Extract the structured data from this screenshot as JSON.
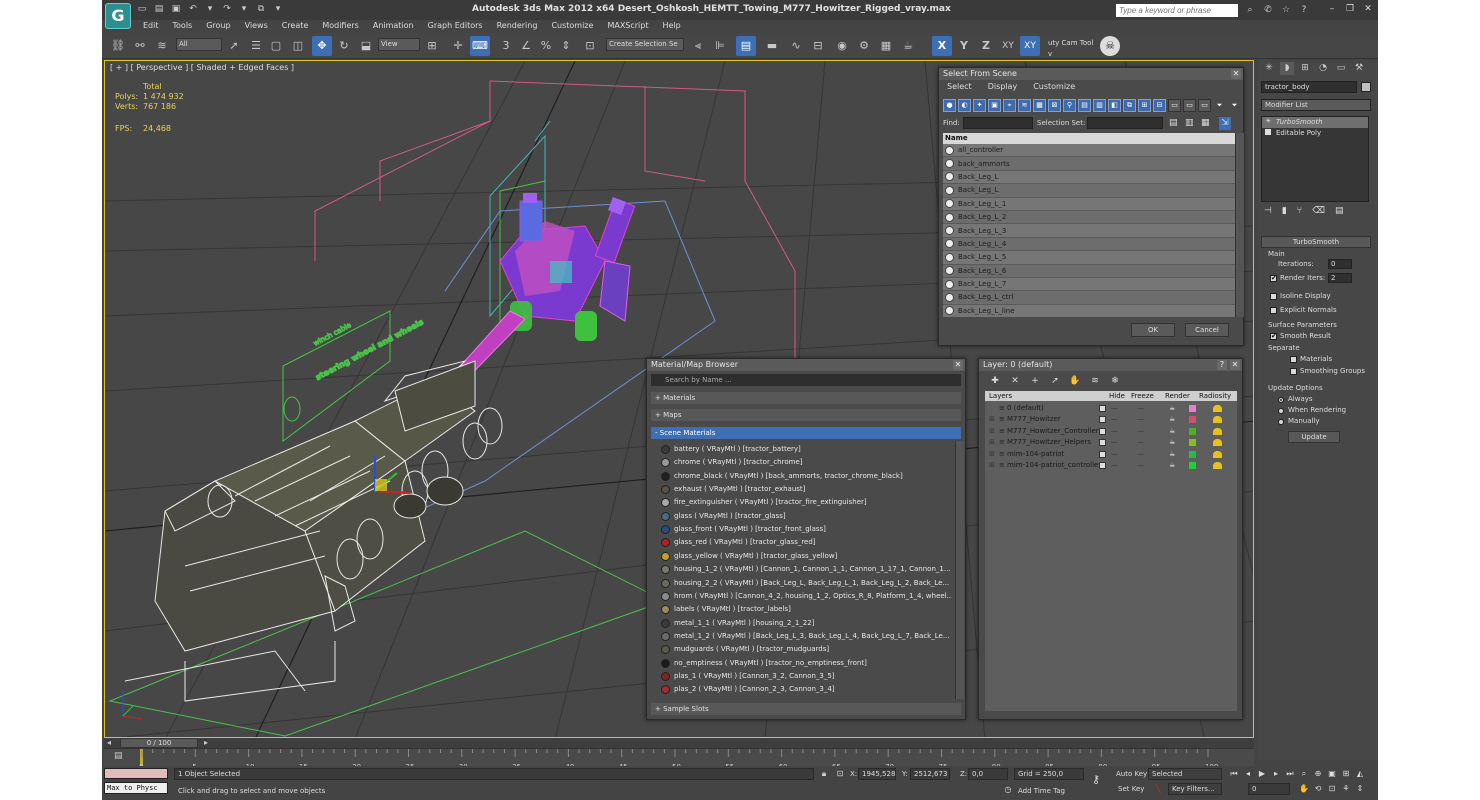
{
  "app": {
    "window_title": "Autodesk 3ds Max  2012 x64     Desert_Oshkosh_HEMTT_Towing_M777_Howitzer_Rigged_vray.max",
    "logo_letter": "G",
    "search_placeholder": "Type a keyword or phrase"
  },
  "menu": [
    "Edit",
    "Tools",
    "Group",
    "Views",
    "Create",
    "Modifiers",
    "Animation",
    "Graph Editors",
    "Rendering",
    "Customize",
    "MAXScript",
    "Help"
  ],
  "toolbar": {
    "filter_value": "All",
    "refcoord_value": "View",
    "selection_set_placeholder": "Create Selection Se",
    "axis_x": "X",
    "axis_y": "Y",
    "axis_z": "Z",
    "axis_xy": "XY",
    "axis_xy2": "XY",
    "cam_tool": "uty Cam Tool v"
  },
  "viewport": {
    "label": "[ + ] [ Perspective ] [ Shaded + Edged Faces ]",
    "stats_header": "Total",
    "polys_label": "Polys:",
    "polys_value": "1 474 932",
    "verts_label": "Verts:",
    "verts_value": "767 186",
    "fps_label": "FPS:",
    "fps_value": "24,468",
    "sign1": "steering wheel and wheels",
    "sign2": "winch cable"
  },
  "select_from_scene": {
    "title": "Select From Scene",
    "menus": [
      "Select",
      "Display",
      "Customize"
    ],
    "find_label": "Find:",
    "selset_label": "Selection Set:",
    "column_name": "Name",
    "items": [
      "all_controller",
      "back_ammorts",
      "Back_Leg_L",
      "Back_Leg_L",
      "Back_Leg_L_1",
      "Back_Leg_L_2",
      "Back_Leg_L_3",
      "Back_Leg_L_4",
      "Back_Leg_L_5",
      "Back_Leg_L_6",
      "Back_Leg_L_7",
      "Back_Leg_L_ctrl",
      "Back_Leg_L_line"
    ],
    "ok": "OK",
    "cancel": "Cancel"
  },
  "material_browser": {
    "title": "Material/Map Browser",
    "search_placeholder": "Search by Name ...",
    "groups": {
      "materials": "+ Materials",
      "maps": "+ Maps",
      "scene_materials": "- Scene Materials",
      "sample_slots": "+ Sample Slots"
    },
    "items": [
      {
        "text": "battery  ( VRayMtl )  [tractor_battery]",
        "color": "#3a3a3a"
      },
      {
        "text": "chrome  ( VRayMtl )  [tractor_chrome]",
        "color": "#9a9a9a"
      },
      {
        "text": "chrome_black  ( VRayMtl )  [back_ammorts, tractor_chrome_black]",
        "color": "#202020"
      },
      {
        "text": "exhaust  ( VRayMtl )  [tractor_exhaust]",
        "color": "#5a5048"
      },
      {
        "text": "fire_extinguisher  ( VRayMtl )  [tractor_fire_extinguisher]",
        "color": "#aaaaaa"
      },
      {
        "text": "glass  ( VRayMtl )  [tractor_glass]",
        "color": "#4a6a8a"
      },
      {
        "text": "glass_front  ( VRayMtl )  [tractor_front_glass]",
        "color": "#2a4a7a"
      },
      {
        "text": "glass_red  ( VRayMtl )  [tractor_glass_red]",
        "color": "#b02020"
      },
      {
        "text": "glass_yellow  ( VRayMtl )  [tractor_glass_yellow]",
        "color": "#c8a020"
      },
      {
        "text": "housing_1_2  ( VRayMtl )  [Cannon_1, Cannon_1_1, Cannon_1_17_1, Cannon_1...",
        "color": "#7a7a6a"
      },
      {
        "text": "housing_2_2  ( VRayMtl )  [Back_Leg_L, Back_Leg_L_1, Back_Leg_L_2, Back_Le...",
        "color": "#6a6a5a"
      },
      {
        "text": "hrom  ( VRayMtl )  [Cannon_4_2, housing_1_2, Optics_R_8, Platform_1_4, wheel...",
        "color": "#8a8a8a"
      },
      {
        "text": "labels  ( VRayMtl )  [tractor_labels]",
        "color": "#a08a60"
      },
      {
        "text": "metal_1_1  ( VRayMtl )  [housing_2_1_22]",
        "color": "#3a3a3a"
      },
      {
        "text": "metal_1_2  ( VRayMtl )  [Back_Leg_L_3, Back_Leg_L_4, Back_Leg_L_7, Back_Le...",
        "color": "#6a6a6a"
      },
      {
        "text": "mudguards  ( VRayMtl )  [tractor_mudguards]",
        "color": "#5a5a4a"
      },
      {
        "text": "no_emptiness  ( VRayMtl )  [tractor_no_emptiness_front]",
        "color": "#1a1a1a"
      },
      {
        "text": "plas_1  ( VRayMtl )  [Cannon_3_2, Cannon_3_5]",
        "color": "#8a2020"
      },
      {
        "text": "plas_2  ( VRayMtl )  [Cannon_2_3, Cannon_3_4]",
        "color": "#9a3030"
      }
    ]
  },
  "layer": {
    "title": "Layer: 0 (default)",
    "help": "?",
    "columns": {
      "layers": "Layers",
      "hide": "Hide",
      "freeze": "Freeze",
      "render": "Render",
      "radiosity": "Radiosity"
    },
    "rows": [
      {
        "name": "0 (default)",
        "color": "#e080d0"
      },
      {
        "name": "M777_Howitzer",
        "color": "#d05070"
      },
      {
        "name": "M777_Howitzer_Controllers",
        "color": "#50b020"
      },
      {
        "name": "M777_Howitzer_Helpers",
        "color": "#80c020"
      },
      {
        "name": "mim-104-patriot",
        "color": "#20c040"
      },
      {
        "name": "mim-104-patriot_controllers",
        "color": "#20d030"
      }
    ]
  },
  "command_panel": {
    "object_name": "tractor_body",
    "modifier_list": "Modifier List",
    "stack": [
      "TurboSmooth",
      "Editable Poly"
    ],
    "turbosmooth_title": "TurboSmooth",
    "main_label": "Main",
    "iterations_label": "Iterations:",
    "iterations_value": "0",
    "render_iters_label": "Render Iters:",
    "render_iters_value": "2",
    "isoline": "Isoline Display",
    "explicit_normals": "Explicit Normals",
    "surface_params": "Surface Parameters",
    "smooth_result": "Smooth Result",
    "separate": "Separate",
    "materials": "Materials",
    "smoothing_groups": "Smoothing Groups",
    "update_options": "Update Options",
    "always": "Always",
    "when_rendering": "When Rendering",
    "manually": "Manually",
    "update_button": "Update"
  },
  "timeline": {
    "slider_label": "0 / 100",
    "ticks": [
      "0",
      "5",
      "10",
      "15",
      "20",
      "25",
      "30",
      "35",
      "40",
      "45",
      "50",
      "55",
      "60",
      "65",
      "70",
      "75",
      "80",
      "85",
      "90",
      "95",
      "100"
    ]
  },
  "status": {
    "maxscript_label": "Max to Physc",
    "objects_selected": "1 Object Selected",
    "prompt": "Click and drag to select and move objects",
    "x_label": "X:",
    "x_value": "1945,528",
    "y_label": "Y:",
    "y_value": "2512,673",
    "z_label": "Z:",
    "z_value": "0,0",
    "grid": "Grid = 250,0",
    "add_time_tag": "Add Time Tag",
    "auto_key": "Auto Key",
    "set_key": "Set Key",
    "key_mode": "Selected",
    "key_filters": "Key Filters...",
    "frame": "0"
  }
}
